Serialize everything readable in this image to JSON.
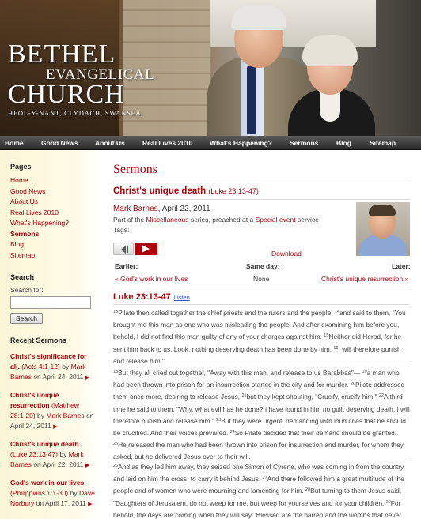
{
  "header": {
    "logo": {
      "line1": "BETHEL",
      "line2": "EVANGELICAL",
      "line3": "CHURCH",
      "address": "HEOL-Y-NANT, CLYDACH, SWANSEA"
    }
  },
  "nav": {
    "items": [
      "Home",
      "Good News",
      "About Us",
      "Real Lives 2010",
      "What's Happening?",
      "Sermons",
      "Blog",
      "Sitemap"
    ]
  },
  "sidebar": {
    "pages_heading": "Pages",
    "pages": [
      "Home",
      "Good News",
      "About Us",
      "Real Lives 2010",
      "What's Happening?",
      "Sermons",
      "Blog",
      "Sitemap"
    ],
    "active_page": "Sermons",
    "search_heading": "Search",
    "search_label": "Search for:",
    "search_value": "",
    "search_button": "Search",
    "recent_heading": "Recent Sermons",
    "recent": [
      {
        "title": "Christ's significance for all.",
        "ref": "(Acts 4:1-12)",
        "by": "by",
        "preacher": "Mark Barnes",
        "date": "on April 24, 2011"
      },
      {
        "title": "Christ's unique resurrection",
        "ref": "(Matthew 28:1-20)",
        "by": "by",
        "preacher": "Mark Barnes",
        "date": "on April 24, 2011"
      },
      {
        "title": "Christ's unique death",
        "ref": "(Luke 23:13-47)",
        "by": "by",
        "preacher": "Mark Barnes",
        "date": "on April 22, 2011"
      },
      {
        "title": "God's work in our lives",
        "ref": "(Philippians 1:1-30)",
        "by": "by",
        "preacher": "Dave Norbury",
        "date": "on April 17, 2011"
      }
    ]
  },
  "main": {
    "page_title": "Sermons",
    "sermon_title": "Christ's unique death",
    "sermon_ref": "(Luke 23:13-47)",
    "preacher": "Mark Barnes",
    "date": ", April 22, 2011",
    "series_pre": "Part of the ",
    "series": "Miscellaneous",
    "series_mid": " series, preached at a ",
    "service": "Special event",
    "series_post": " service",
    "tags": "Tags:",
    "download": "Download",
    "earlier_label": "Earlier:",
    "earlier_value": "« God's work in our lives",
    "sameday_label": "Same day:",
    "sameday_value": "None",
    "later_label": "Later:",
    "later_value": "Christ's unique resurrection »",
    "passage": "Luke 23:13-47",
    "listen": "Listen"
  },
  "colors": {
    "accent": "#b0000a",
    "nav_bg": "#3a3a3a",
    "sidebar_bg": "#fbf6d6"
  }
}
